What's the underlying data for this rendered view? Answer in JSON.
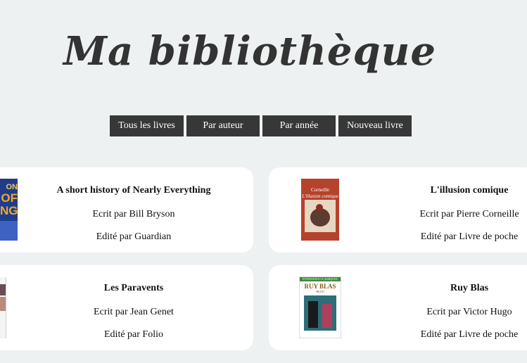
{
  "header": {
    "title": "Ma bibliothèque"
  },
  "nav": [
    {
      "label": "Tous les livres"
    },
    {
      "label": "Par auteur"
    },
    {
      "label": "Par année"
    },
    {
      "label": "Nouveau livre"
    }
  ],
  "books": [
    {
      "title": "A short history of Nearly Everything",
      "author": "Ecrit par Bill Bryson",
      "publisher": "Edité par Guardian"
    },
    {
      "title": "L'illusion comique",
      "author": "Ecrit par Pierre Corneille",
      "publisher": "Edité par Livre de poche"
    },
    {
      "title": "Les Paravents",
      "author": "Ecrit par Jean Genet",
      "publisher": "Edité par Folio"
    },
    {
      "title": "Ruy Blas",
      "author": "Ecrit par Victor Hugo",
      "publisher": "Edité par Livre de poche"
    }
  ],
  "covers": {
    "bryson": {
      "lines": [
        "ON",
        "OF",
        "NG"
      ]
    },
    "corneille": {
      "author": "Corneille",
      "subtitle": "L'illusion comique"
    },
    "ruyblas": {
      "series": "ETONNANTS·CLASSIQUES",
      "title": "RUY BLAS",
      "author": "HUGO"
    }
  }
}
